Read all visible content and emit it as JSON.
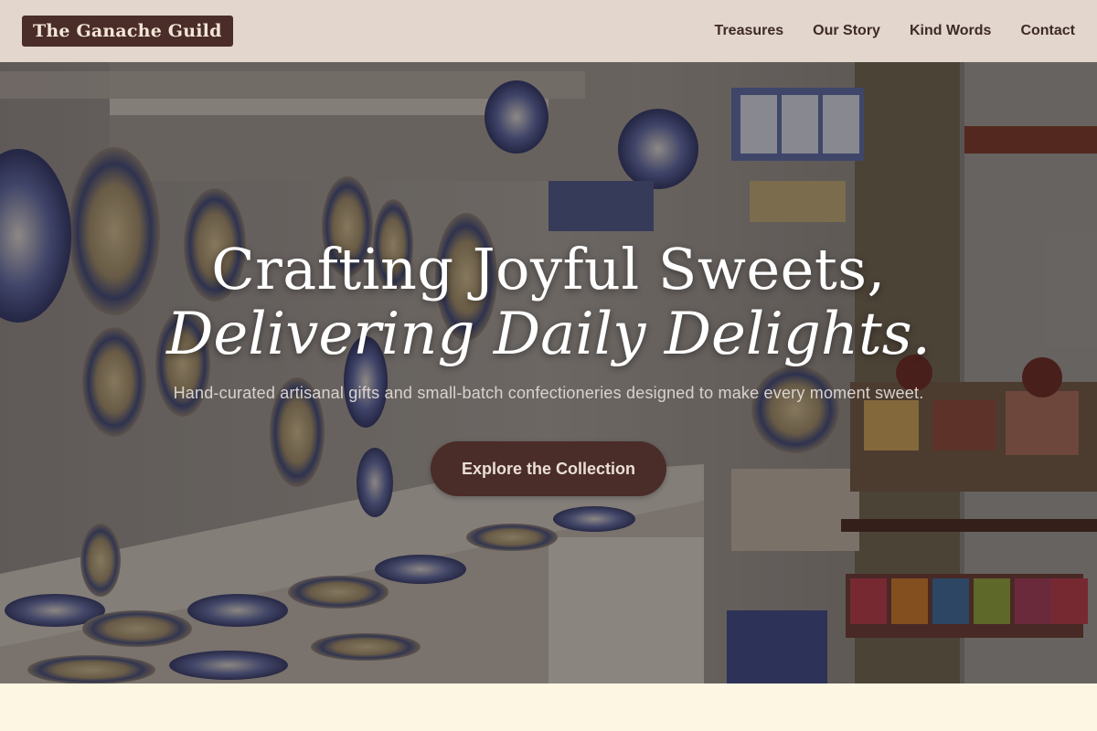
{
  "nav": {
    "brand": "The Ganache Guild",
    "links": [
      "Treasures",
      "Our Story",
      "Kind Words",
      "Contact"
    ]
  },
  "hero": {
    "headline_line1": "Crafting Joyful Sweets,",
    "headline_line2": "Delivering Daily Delights.",
    "subhead": "Hand-curated artisanal gifts and small-batch confectioneries designed to make every moment sweet.",
    "cta_label": "Explore the Collection"
  },
  "colors": {
    "nav_bg": "#e2d6cd",
    "brand_bg": "#4a2c28",
    "cta_bg": "#4a2c28",
    "page_bg": "#fdf6e3"
  }
}
